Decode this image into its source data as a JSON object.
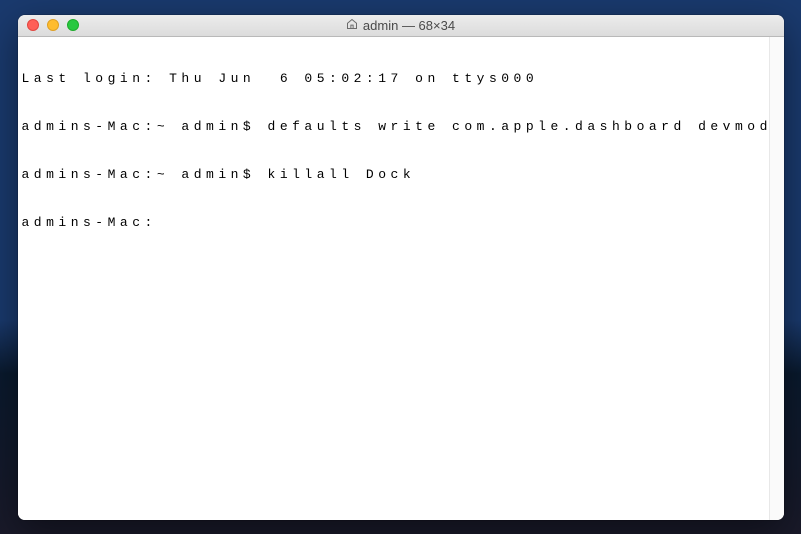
{
  "window": {
    "title": "admin — 68×34"
  },
  "terminal": {
    "lines": [
      "Last login: Thu Jun  6 05:02:17 on ttys000",
      "admins-Mac:~ admin$ defaults write com.apple.dashboard devmode NO",
      "admins-Mac:~ admin$ killall Dock",
      "admins-Mac:"
    ]
  }
}
